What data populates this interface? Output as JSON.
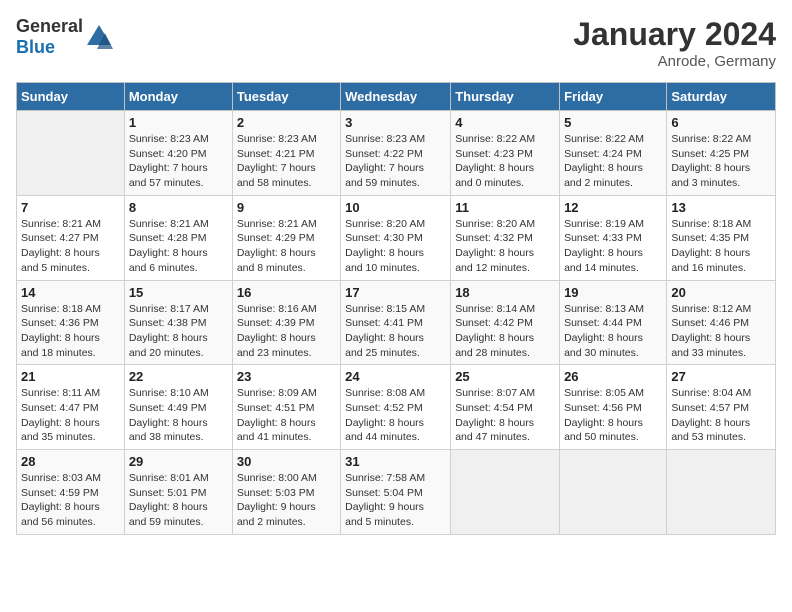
{
  "header": {
    "logo_general": "General",
    "logo_blue": "Blue",
    "title": "January 2024",
    "subtitle": "Anrode, Germany"
  },
  "calendar": {
    "days_of_week": [
      "Sunday",
      "Monday",
      "Tuesday",
      "Wednesday",
      "Thursday",
      "Friday",
      "Saturday"
    ],
    "weeks": [
      [
        {
          "day": "",
          "info": ""
        },
        {
          "day": "1",
          "info": "Sunrise: 8:23 AM\nSunset: 4:20 PM\nDaylight: 7 hours\nand 57 minutes."
        },
        {
          "day": "2",
          "info": "Sunrise: 8:23 AM\nSunset: 4:21 PM\nDaylight: 7 hours\nand 58 minutes."
        },
        {
          "day": "3",
          "info": "Sunrise: 8:23 AM\nSunset: 4:22 PM\nDaylight: 7 hours\nand 59 minutes."
        },
        {
          "day": "4",
          "info": "Sunrise: 8:22 AM\nSunset: 4:23 PM\nDaylight: 8 hours\nand 0 minutes."
        },
        {
          "day": "5",
          "info": "Sunrise: 8:22 AM\nSunset: 4:24 PM\nDaylight: 8 hours\nand 2 minutes."
        },
        {
          "day": "6",
          "info": "Sunrise: 8:22 AM\nSunset: 4:25 PM\nDaylight: 8 hours\nand 3 minutes."
        }
      ],
      [
        {
          "day": "7",
          "info": "Sunrise: 8:21 AM\nSunset: 4:27 PM\nDaylight: 8 hours\nand 5 minutes."
        },
        {
          "day": "8",
          "info": "Sunrise: 8:21 AM\nSunset: 4:28 PM\nDaylight: 8 hours\nand 6 minutes."
        },
        {
          "day": "9",
          "info": "Sunrise: 8:21 AM\nSunset: 4:29 PM\nDaylight: 8 hours\nand 8 minutes."
        },
        {
          "day": "10",
          "info": "Sunrise: 8:20 AM\nSunset: 4:30 PM\nDaylight: 8 hours\nand 10 minutes."
        },
        {
          "day": "11",
          "info": "Sunrise: 8:20 AM\nSunset: 4:32 PM\nDaylight: 8 hours\nand 12 minutes."
        },
        {
          "day": "12",
          "info": "Sunrise: 8:19 AM\nSunset: 4:33 PM\nDaylight: 8 hours\nand 14 minutes."
        },
        {
          "day": "13",
          "info": "Sunrise: 8:18 AM\nSunset: 4:35 PM\nDaylight: 8 hours\nand 16 minutes."
        }
      ],
      [
        {
          "day": "14",
          "info": "Sunrise: 8:18 AM\nSunset: 4:36 PM\nDaylight: 8 hours\nand 18 minutes."
        },
        {
          "day": "15",
          "info": "Sunrise: 8:17 AM\nSunset: 4:38 PM\nDaylight: 8 hours\nand 20 minutes."
        },
        {
          "day": "16",
          "info": "Sunrise: 8:16 AM\nSunset: 4:39 PM\nDaylight: 8 hours\nand 23 minutes."
        },
        {
          "day": "17",
          "info": "Sunrise: 8:15 AM\nSunset: 4:41 PM\nDaylight: 8 hours\nand 25 minutes."
        },
        {
          "day": "18",
          "info": "Sunrise: 8:14 AM\nSunset: 4:42 PM\nDaylight: 8 hours\nand 28 minutes."
        },
        {
          "day": "19",
          "info": "Sunrise: 8:13 AM\nSunset: 4:44 PM\nDaylight: 8 hours\nand 30 minutes."
        },
        {
          "day": "20",
          "info": "Sunrise: 8:12 AM\nSunset: 4:46 PM\nDaylight: 8 hours\nand 33 minutes."
        }
      ],
      [
        {
          "day": "21",
          "info": "Sunrise: 8:11 AM\nSunset: 4:47 PM\nDaylight: 8 hours\nand 35 minutes."
        },
        {
          "day": "22",
          "info": "Sunrise: 8:10 AM\nSunset: 4:49 PM\nDaylight: 8 hours\nand 38 minutes."
        },
        {
          "day": "23",
          "info": "Sunrise: 8:09 AM\nSunset: 4:51 PM\nDaylight: 8 hours\nand 41 minutes."
        },
        {
          "day": "24",
          "info": "Sunrise: 8:08 AM\nSunset: 4:52 PM\nDaylight: 8 hours\nand 44 minutes."
        },
        {
          "day": "25",
          "info": "Sunrise: 8:07 AM\nSunset: 4:54 PM\nDaylight: 8 hours\nand 47 minutes."
        },
        {
          "day": "26",
          "info": "Sunrise: 8:05 AM\nSunset: 4:56 PM\nDaylight: 8 hours\nand 50 minutes."
        },
        {
          "day": "27",
          "info": "Sunrise: 8:04 AM\nSunset: 4:57 PM\nDaylight: 8 hours\nand 53 minutes."
        }
      ],
      [
        {
          "day": "28",
          "info": "Sunrise: 8:03 AM\nSunset: 4:59 PM\nDaylight: 8 hours\nand 56 minutes."
        },
        {
          "day": "29",
          "info": "Sunrise: 8:01 AM\nSunset: 5:01 PM\nDaylight: 8 hours\nand 59 minutes."
        },
        {
          "day": "30",
          "info": "Sunrise: 8:00 AM\nSunset: 5:03 PM\nDaylight: 9 hours\nand 2 minutes."
        },
        {
          "day": "31",
          "info": "Sunrise: 7:58 AM\nSunset: 5:04 PM\nDaylight: 9 hours\nand 5 minutes."
        },
        {
          "day": "",
          "info": ""
        },
        {
          "day": "",
          "info": ""
        },
        {
          "day": "",
          "info": ""
        }
      ]
    ]
  }
}
